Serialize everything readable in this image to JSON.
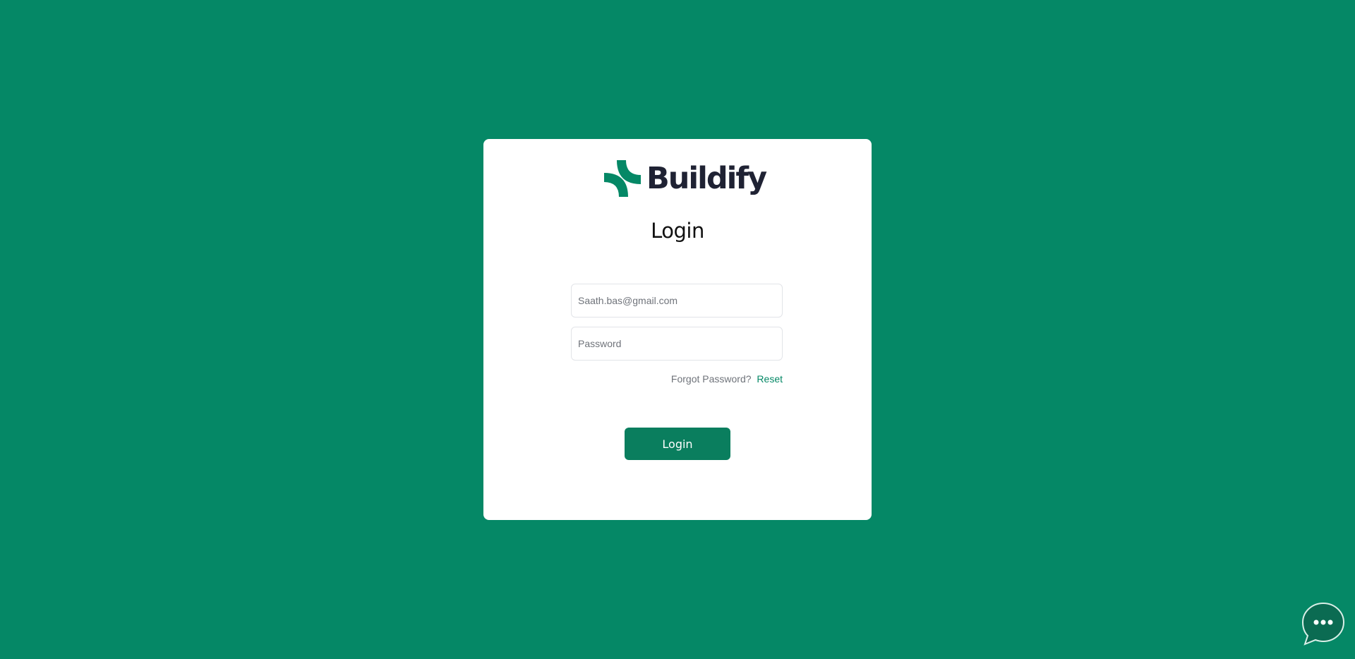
{
  "brand": {
    "name": "Buildify",
    "icon": "buildify-logo-mark",
    "color": "#058866"
  },
  "login_form": {
    "title": "Login",
    "email_placeholder": "Saath.bas@gmail.com",
    "password_placeholder": "Password",
    "forgot_label": "Forgot Password?",
    "reset_label": "Reset",
    "submit_label": "Login"
  },
  "chat_widget": {
    "icon": "chat-bubble-icon"
  },
  "colors": {
    "background": "#058866",
    "button": "#0a7e5e",
    "card": "#ffffff"
  }
}
